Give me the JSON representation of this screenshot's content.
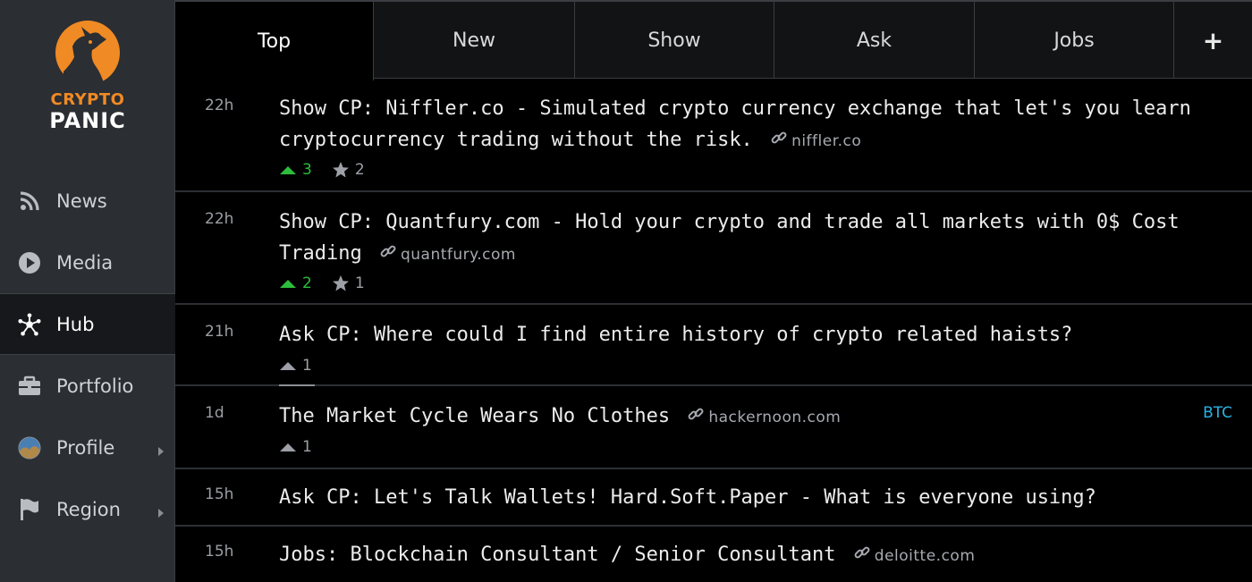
{
  "app": {
    "logo_line1": "CRYPTO",
    "logo_line2": "PANIC",
    "accent": "#f08a24"
  },
  "sidebar": {
    "items": [
      {
        "label": "News",
        "icon": "rss-icon",
        "active": false,
        "has_chevron": false
      },
      {
        "label": "Media",
        "icon": "play-circle-icon",
        "active": false,
        "has_chevron": false
      },
      {
        "label": "Hub",
        "icon": "hub-network-icon",
        "active": true,
        "has_chevron": false
      },
      {
        "label": "Portfolio",
        "icon": "briefcase-icon",
        "active": false,
        "has_chevron": false
      },
      {
        "label": "Profile",
        "icon": "avatar-icon",
        "active": false,
        "has_chevron": true
      },
      {
        "label": "Region",
        "icon": "flag-icon",
        "active": false,
        "has_chevron": true
      }
    ]
  },
  "tabs": [
    {
      "label": "Top",
      "active": true
    },
    {
      "label": "New",
      "active": false
    },
    {
      "label": "Show",
      "active": false
    },
    {
      "label": "Ask",
      "active": false
    },
    {
      "label": "Jobs",
      "active": false
    },
    {
      "label": "+",
      "active": false
    }
  ],
  "posts": [
    {
      "time": "22h",
      "title": "Show CP: Niffler.co - Simulated crypto currency exchange that let's you learn cryptocurrency trading without the risk.",
      "domain": "niffler.co",
      "votes": "3",
      "vote_color": "green",
      "stars": "2",
      "tag": ""
    },
    {
      "time": "22h",
      "title": "Show CP: Quantfury.com - Hold your crypto and trade all markets with 0$ Cost Trading",
      "domain": "quantfury.com",
      "votes": "2",
      "vote_color": "green",
      "stars": "1",
      "tag": ""
    },
    {
      "time": "21h",
      "title": "Ask CP: Where could I find entire history of crypto related haists?",
      "domain": "",
      "votes": "1",
      "vote_color": "gray",
      "stars": "",
      "tag": ""
    },
    {
      "time": "1d",
      "title": "The Market Cycle Wears No Clothes",
      "domain": "hackernoon.com",
      "votes": "1",
      "vote_color": "gray",
      "stars": "",
      "tag": "BTC"
    },
    {
      "time": "15h",
      "title": "Ask CP: Let's Talk Wallets! Hard.Soft.Paper - What is everyone using?",
      "domain": "",
      "votes": "",
      "vote_color": "",
      "stars": "",
      "tag": ""
    },
    {
      "time": "15h",
      "title": "Jobs: Blockchain Consultant / Senior Consultant",
      "domain": "deloitte.com",
      "votes": "",
      "vote_color": "",
      "stars": "",
      "tag": ""
    }
  ]
}
